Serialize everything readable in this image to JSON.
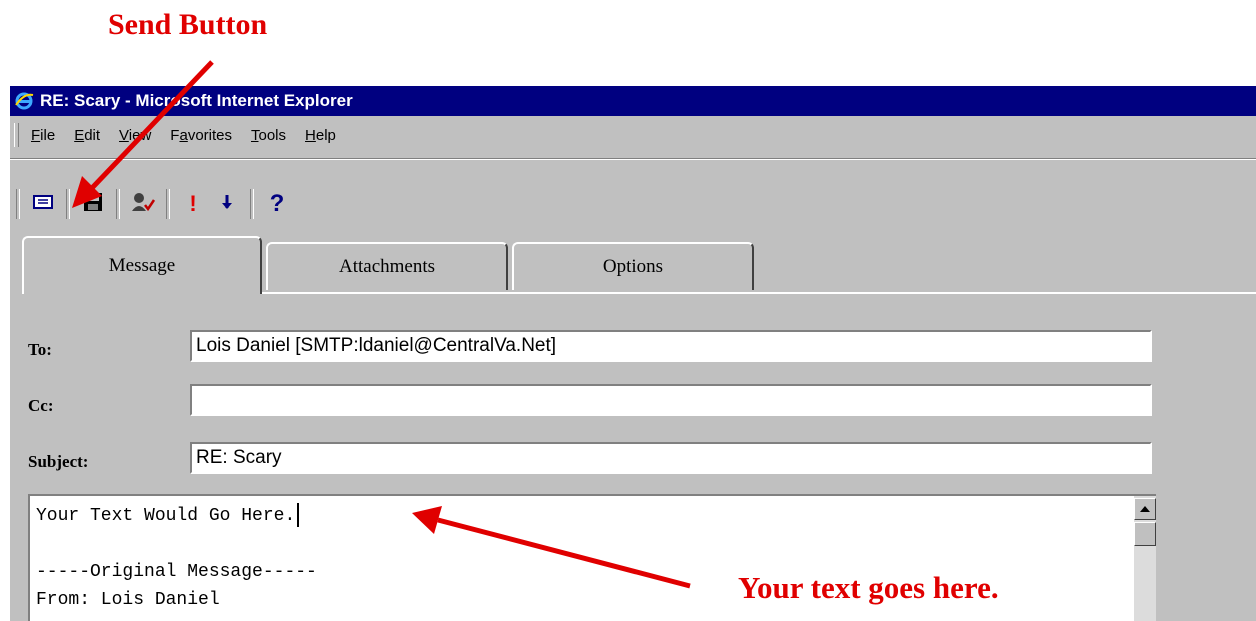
{
  "annotations": {
    "send_button": "Send Button",
    "text_goes_here": "Your text goes here."
  },
  "window": {
    "title": "RE: Scary - Microsoft Internet Explorer"
  },
  "menu": {
    "items": [
      {
        "accel": "F",
        "rest": "ile"
      },
      {
        "accel": "E",
        "rest": "dit"
      },
      {
        "accel": "V",
        "rest": "iew"
      },
      {
        "pre": "F",
        "accel": "a",
        "rest": "vorites"
      },
      {
        "accel": "T",
        "rest": "ools"
      },
      {
        "accel": "H",
        "rest": "elp"
      }
    ]
  },
  "toolbar": {
    "icons": [
      "send-icon",
      "save-icon",
      "check-names-icon",
      "high-importance-icon",
      "low-importance-icon",
      "help-icon"
    ],
    "help_glyph": "?",
    "high_glyph": "!"
  },
  "tabs": [
    {
      "label": "Message"
    },
    {
      "label": "Attachments"
    },
    {
      "label": "Options"
    }
  ],
  "fields": {
    "to_label": "To:",
    "to_value": "Lois Daniel [SMTP:ldaniel@CentralVa.Net]",
    "cc_label": "Cc:",
    "cc_value": "",
    "subject_label": "Subject:",
    "subject_value": "RE: Scary"
  },
  "body": {
    "line1": "Your Text Would Go Here.",
    "line2": "",
    "line3": "-----Original Message-----",
    "line4": "From: Lois Daniel"
  },
  "colors": {
    "annotation": "#e00000",
    "titlebar": "#000080",
    "chrome": "#c0c0c0"
  }
}
